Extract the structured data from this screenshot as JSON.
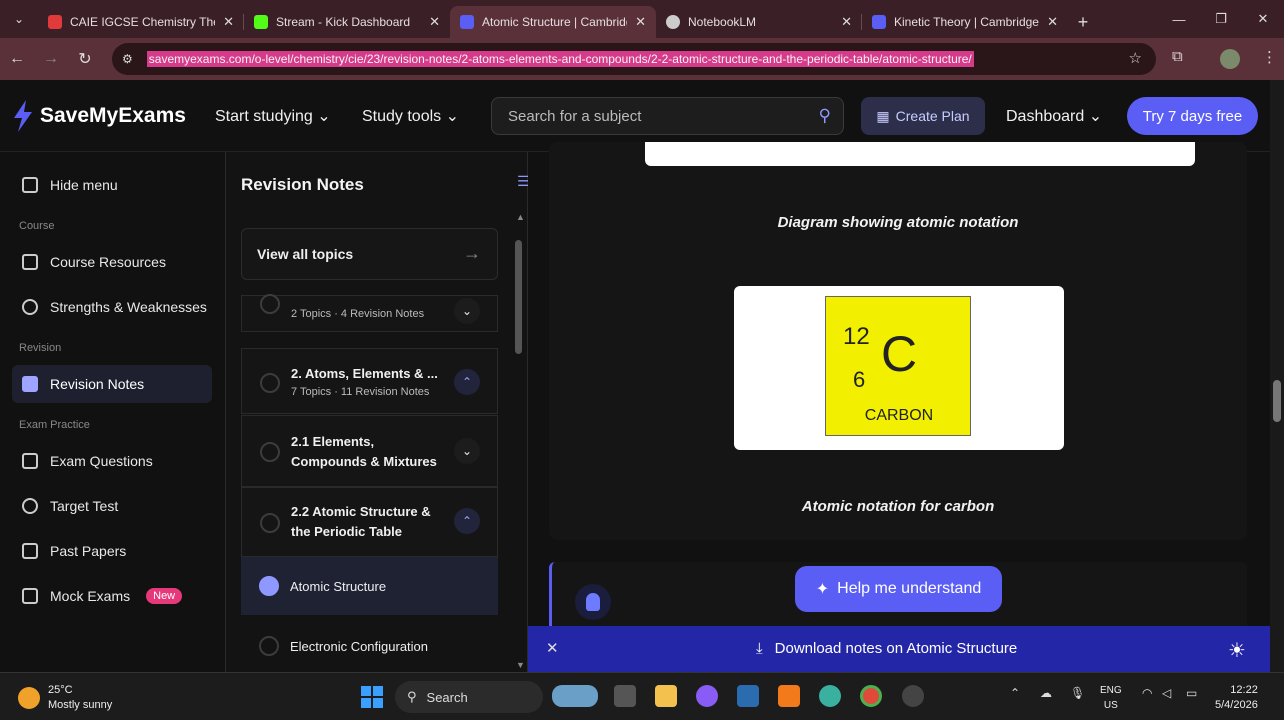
{
  "browser": {
    "tabs": [
      {
        "title": "CAIE IGCSE Chemistry Theor",
        "color": "#e03a3a"
      },
      {
        "title": "Stream - Kick Dashboard",
        "color": "#53fc18"
      },
      {
        "title": "Atomic Structure | Cambridge",
        "color": "#5b5ef5"
      },
      {
        "title": "NotebookLM",
        "color": "#cccccc"
      },
      {
        "title": "Kinetic Theory | Cambridge",
        "color": "#5b5ef5"
      }
    ],
    "url": "savemyexams.com/o-level/chemistry/cie/23/revision-notes/2-atoms-elements-and-compounds/2-2-atomic-structure-and-the-periodic-table/atomic-structure/"
  },
  "site": {
    "brand": "SaveMyExams",
    "nav": {
      "start": "Start studying",
      "tools": "Study tools",
      "search_placeholder": "Search for a subject",
      "create_plan": "Create Plan",
      "dashboard": "Dashboard",
      "trial": "Try 7 days free"
    }
  },
  "sidebar": {
    "hide": "Hide menu",
    "course_section": "Course",
    "course_resources": "Course Resources",
    "strengths": "Strengths & Weaknesses",
    "revision_section": "Revision",
    "revision_notes": "Revision Notes",
    "exam_section": "Exam Practice",
    "exam_questions": "Exam Questions",
    "target_test": "Target Test",
    "past_papers": "Past Papers",
    "mock_exams": "Mock Exams",
    "new_badge": "New"
  },
  "notes_panel": {
    "title": "Revision Notes",
    "view_all": "View all topics",
    "card0_sub": "2 Topics · 4 Revision Notes",
    "card1_title": "2. Atoms, Elements & ...",
    "card1_sub": "7 Topics · 11 Revision Notes",
    "card2_title": "2.1 Elements, Compounds & Mixtures",
    "card3_title": "2.2 Atomic Structure & the Periodic Table",
    "leaf1": "Atomic Structure",
    "leaf2": "Electronic Configuration"
  },
  "content": {
    "caption1": "Diagram showing atomic notation",
    "element": {
      "mass": "12",
      "number": "6",
      "symbol": "C",
      "name": "CARBON"
    },
    "caption2": "Atomic notation for carbon",
    "help": "Help me understand",
    "download": "Download notes on Atomic Structure"
  },
  "taskbar": {
    "temp": "25°C",
    "weather": "Mostly sunny",
    "search": "Search",
    "lang1": "ENG",
    "lang2": "US",
    "time": "12:22",
    "date": "5/4/2026"
  }
}
